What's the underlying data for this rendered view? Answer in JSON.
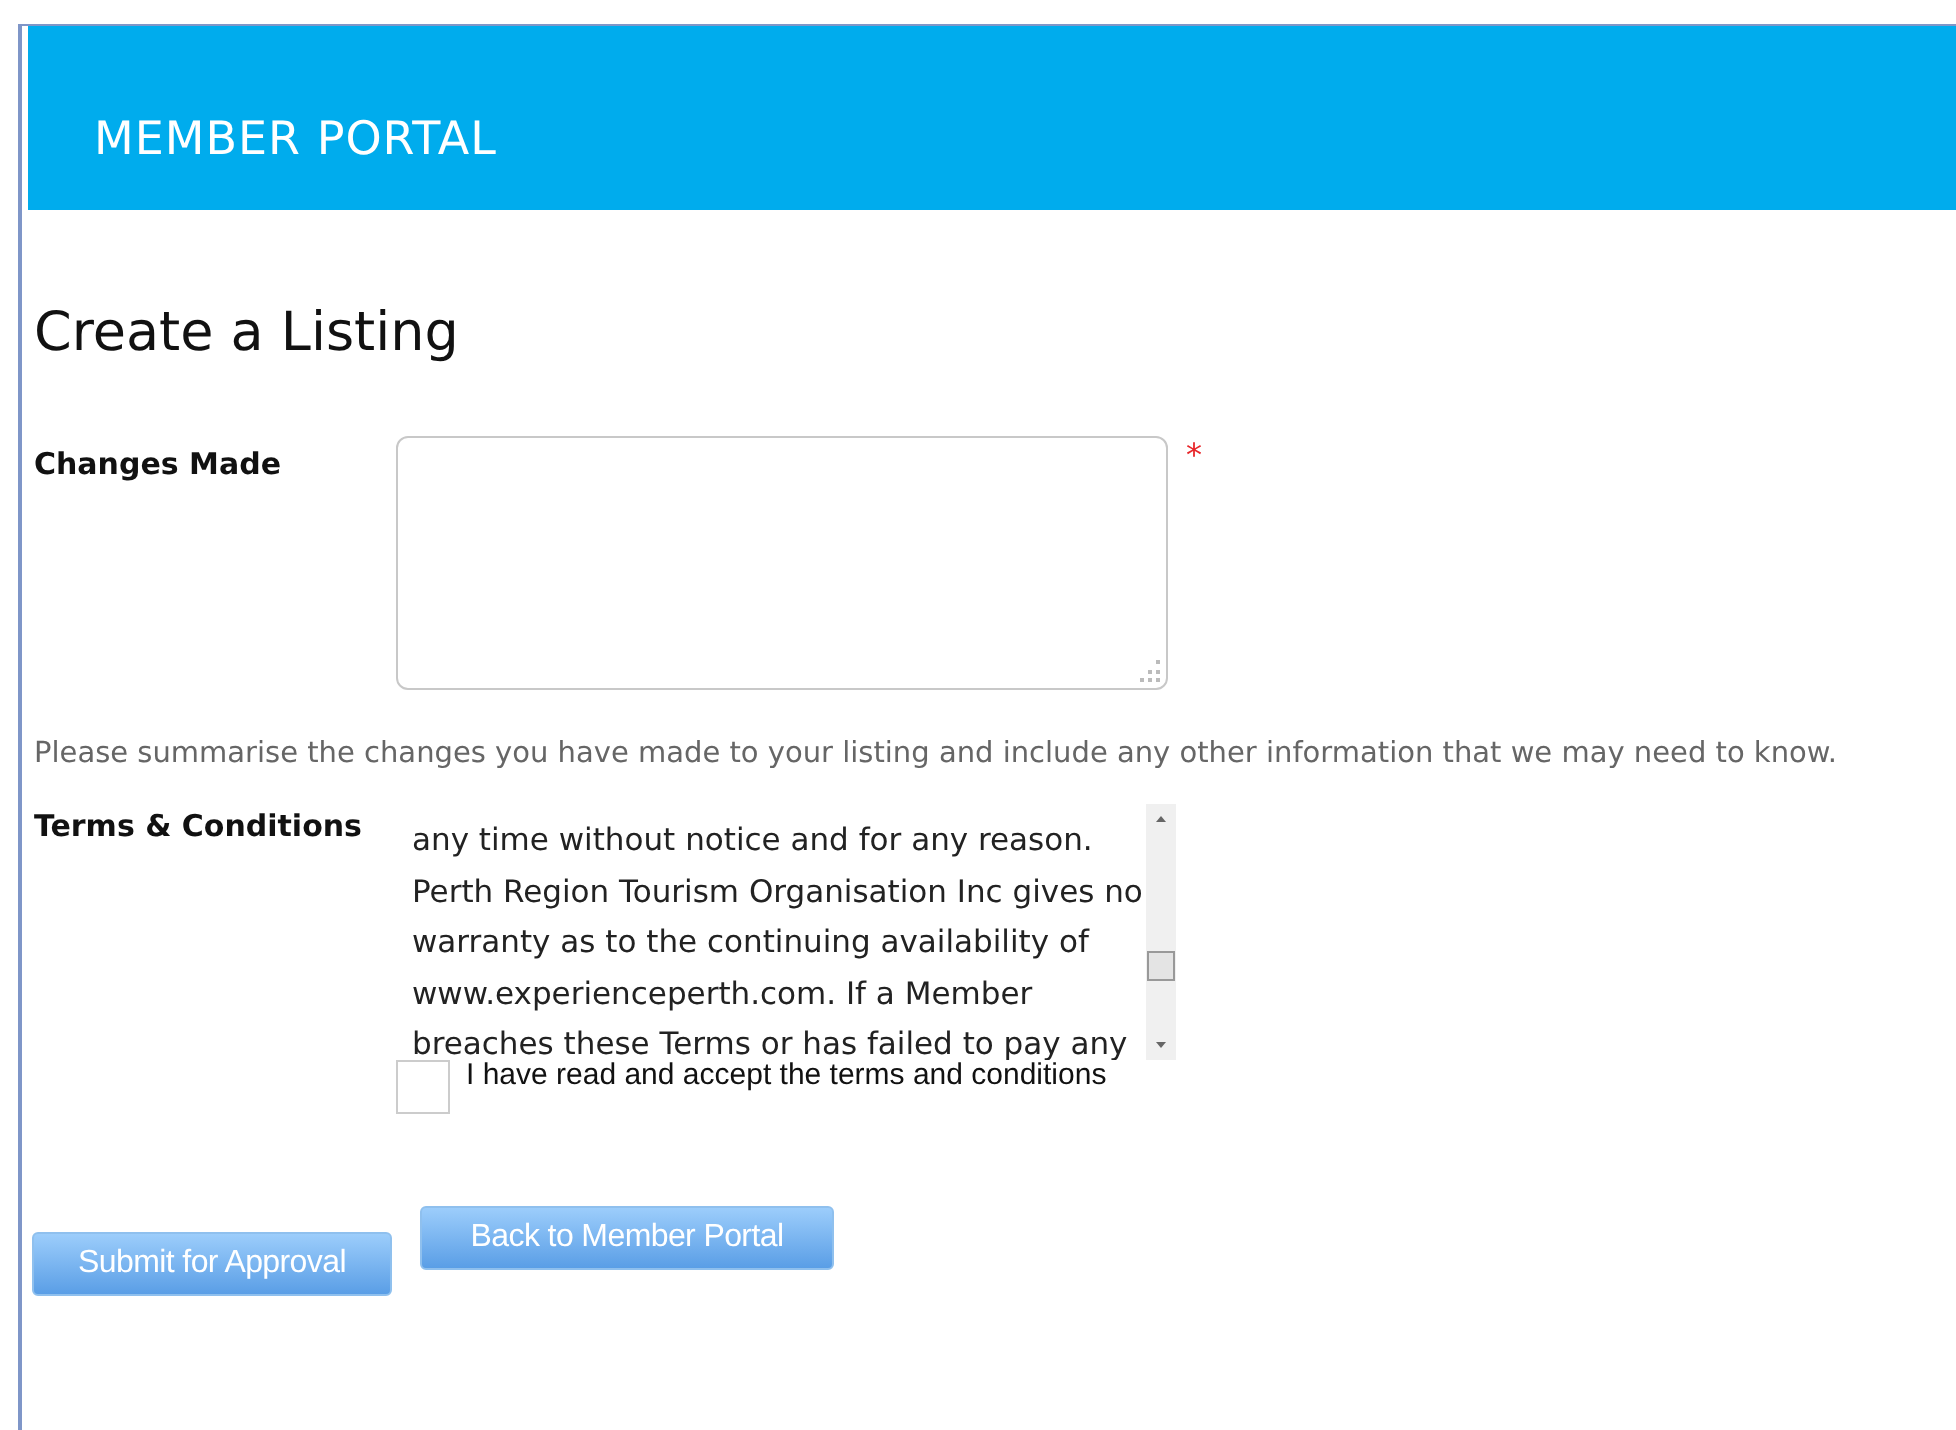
{
  "header": {
    "title": "MEMBER PORTAL"
  },
  "page_title": "Create a Listing",
  "changes_field": {
    "label": "Changes Made",
    "required_mark": "*",
    "help": "Please summarise the changes you have made to your listing and include any other information that we may need to know."
  },
  "terms": {
    "label": "Terms & Conditions",
    "lines": [
      "any time without notice and for any reason.",
      "Perth Region Tourism Organisation Inc gives no",
      "warranty as to the continuing availability of",
      "www.experienceperth.com. If a Member",
      "breaches these Terms or has failed to pay any"
    ]
  },
  "accept": {
    "label": "I have read and accept the terms and conditions",
    "checked": false
  },
  "buttons": [
    {
      "label": "Submit for Approval",
      "kind": "submit"
    },
    {
      "label": "Back to Member Portal",
      "kind": "back"
    }
  ]
}
